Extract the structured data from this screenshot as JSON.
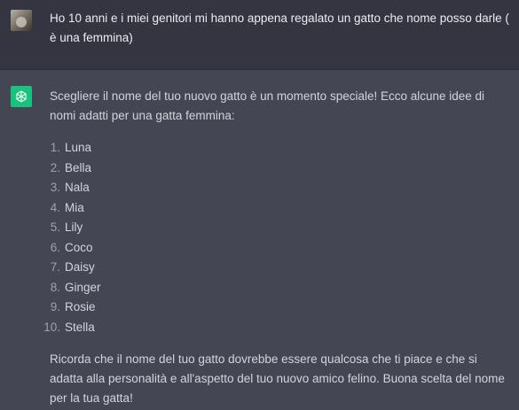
{
  "user_message": {
    "text": "Ho 10 anni e i miei genitori mi hanno appena regalato un gatto che nome posso darle ( è una femmina)"
  },
  "assistant_message": {
    "intro": "Scegliere il nome del tuo nuovo gatto è un momento speciale! Ecco alcune idee di nomi adatti per una gatta femmina:",
    "names": [
      {
        "num": "1.",
        "label": "Luna"
      },
      {
        "num": "2.",
        "label": "Bella"
      },
      {
        "num": "3.",
        "label": "Nala"
      },
      {
        "num": "4.",
        "label": "Mia"
      },
      {
        "num": "5.",
        "label": "Lily"
      },
      {
        "num": "6.",
        "label": "Coco"
      },
      {
        "num": "7.",
        "label": "Daisy"
      },
      {
        "num": "8.",
        "label": "Ginger"
      },
      {
        "num": "9.",
        "label": "Rosie"
      },
      {
        "num": "10.",
        "label": "Stella"
      }
    ],
    "outro": "Ricorda che il nome del tuo gatto dovrebbe essere qualcosa che ti piace e che si adatta alla personalità e all'aspetto del tuo nuovo amico felino. Buona scelta del nome per la tua gatta!"
  },
  "colors": {
    "user_bg": "#343541",
    "assistant_bg": "#444654",
    "assistant_icon_bg": "#19c37d"
  },
  "icons": {
    "user_avatar": "user-avatar-photo",
    "assistant": "openai-logo-icon"
  }
}
